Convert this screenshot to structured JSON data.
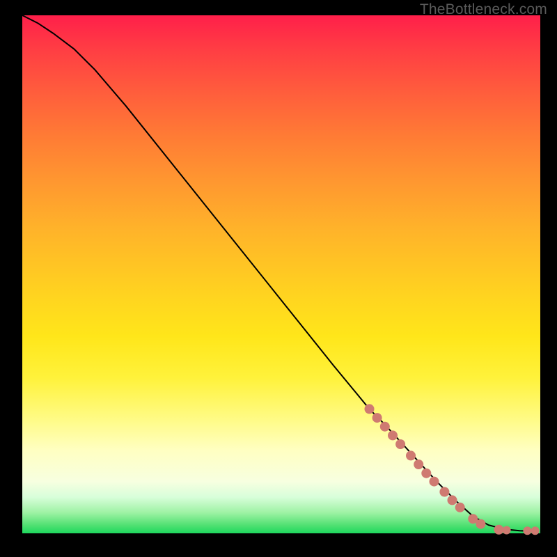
{
  "watermark": "TheBottleneck.com",
  "chart_data": {
    "type": "line",
    "title": "",
    "xlabel": "",
    "ylabel": "",
    "xlim": [
      0,
      100
    ],
    "ylim": [
      0,
      100
    ],
    "grid": false,
    "legend": false,
    "curve": {
      "name": "bottleneck-curve",
      "points": [
        {
          "x": 0,
          "y": 100
        },
        {
          "x": 3,
          "y": 98.5
        },
        {
          "x": 6,
          "y": 96.5
        },
        {
          "x": 10,
          "y": 93.5
        },
        {
          "x": 14,
          "y": 89.5
        },
        {
          "x": 20,
          "y": 82.5
        },
        {
          "x": 30,
          "y": 70
        },
        {
          "x": 40,
          "y": 57.5
        },
        {
          "x": 50,
          "y": 45
        },
        {
          "x": 60,
          "y": 32.5
        },
        {
          "x": 67,
          "y": 24
        },
        {
          "x": 70,
          "y": 21
        },
        {
          "x": 75,
          "y": 15.5
        },
        {
          "x": 80,
          "y": 10
        },
        {
          "x": 84,
          "y": 6
        },
        {
          "x": 87,
          "y": 3.3
        },
        {
          "x": 90,
          "y": 1.6
        },
        {
          "x": 93,
          "y": 0.8
        },
        {
          "x": 96,
          "y": 0.5
        },
        {
          "x": 99,
          "y": 0.4
        }
      ]
    },
    "markers": {
      "name": "sample-points",
      "color": "#cf7a71",
      "points": [
        {
          "x": 67.0,
          "y": 24.0,
          "r": 7
        },
        {
          "x": 68.5,
          "y": 22.3,
          "r": 7
        },
        {
          "x": 70.0,
          "y": 20.6,
          "r": 7
        },
        {
          "x": 71.5,
          "y": 18.9,
          "r": 7
        },
        {
          "x": 73.0,
          "y": 17.2,
          "r": 7
        },
        {
          "x": 75.0,
          "y": 15.0,
          "r": 7
        },
        {
          "x": 76.5,
          "y": 13.3,
          "r": 7
        },
        {
          "x": 78.0,
          "y": 11.6,
          "r": 7
        },
        {
          "x": 79.5,
          "y": 10.0,
          "r": 7
        },
        {
          "x": 81.5,
          "y": 8.0,
          "r": 7
        },
        {
          "x": 83.0,
          "y": 6.4,
          "r": 7
        },
        {
          "x": 84.5,
          "y": 5.0,
          "r": 7
        },
        {
          "x": 87.0,
          "y": 2.8,
          "r": 7
        },
        {
          "x": 88.5,
          "y": 1.8,
          "r": 7
        },
        {
          "x": 92.0,
          "y": 0.7,
          "r": 7
        },
        {
          "x": 93.5,
          "y": 0.6,
          "r": 6
        },
        {
          "x": 97.5,
          "y": 0.5,
          "r": 6
        },
        {
          "x": 99.0,
          "y": 0.5,
          "r": 6
        }
      ]
    }
  }
}
